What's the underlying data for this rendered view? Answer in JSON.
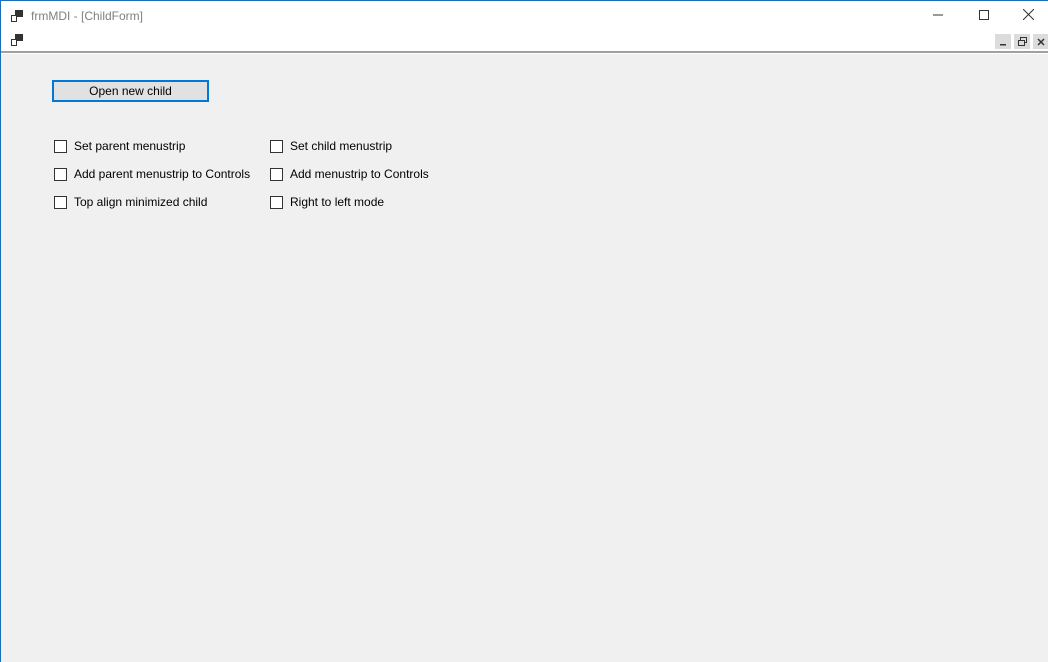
{
  "window": {
    "title": "frmMDI - [ChildForm]",
    "accent_color": "#1b6fb8"
  },
  "icons": {
    "app": "mdi-app-icon",
    "child": "child-form-icon",
    "minimize": "minimize-icon",
    "maximize": "maximize-icon",
    "close": "close-icon",
    "child_minimize": "child-minimize-icon",
    "child_restore": "child-restore-icon",
    "child_close": "child-close-icon"
  },
  "child_form": {
    "open_button_label": "Open new child",
    "checkboxes": [
      {
        "label": "Set parent menustrip",
        "checked": false
      },
      {
        "label": "Set child menustrip",
        "checked": false
      },
      {
        "label": "Add parent menustrip to Controls",
        "checked": false
      },
      {
        "label": "Add menustrip to Controls",
        "checked": false
      },
      {
        "label": "Top align minimized child",
        "checked": false
      },
      {
        "label": "Right to left mode",
        "checked": false
      }
    ]
  }
}
